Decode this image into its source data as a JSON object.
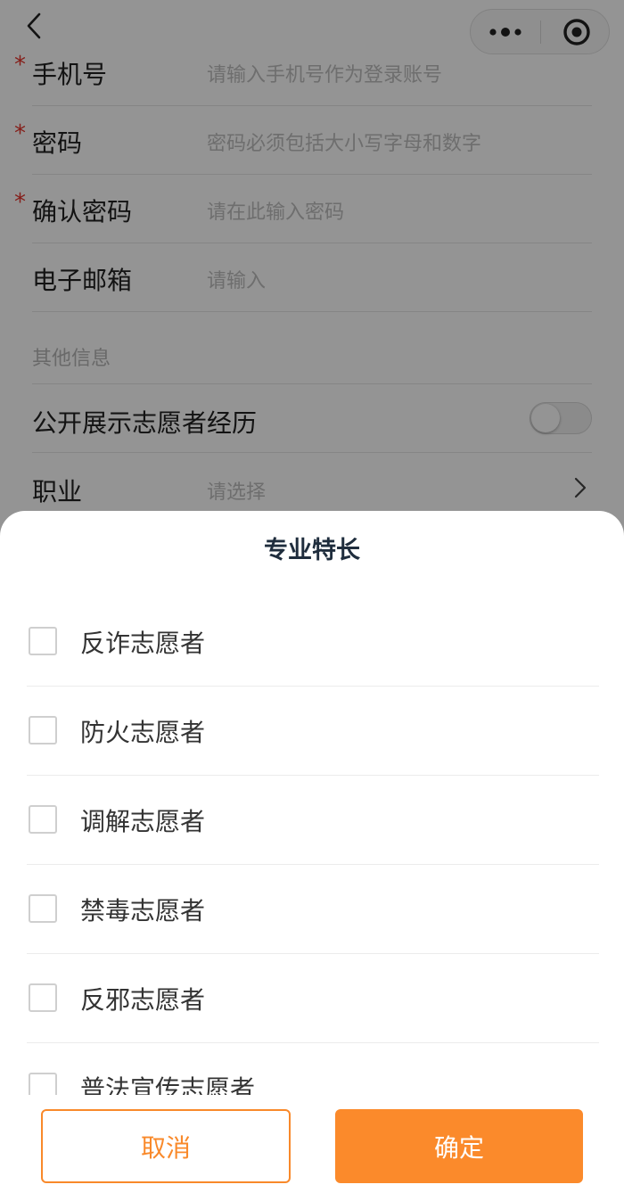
{
  "form": {
    "fields": [
      {
        "label": "手机号",
        "required": "*",
        "placeholder": "请输入手机号作为登录账号"
      },
      {
        "label": "密码",
        "required": "*",
        "placeholder": "密码必须包括大小写字母和数字"
      },
      {
        "label": "确认密码",
        "required": "*",
        "placeholder": "请在此输入密码"
      },
      {
        "label": "电子邮箱",
        "required": "",
        "placeholder": "请输入"
      }
    ],
    "section_other": "其他信息",
    "public_history_label": "公开展示志愿者经历",
    "public_history_on": false,
    "occupation_label": "职业",
    "occupation_placeholder": "请选择"
  },
  "sheet": {
    "title": "专业特长",
    "options": [
      {
        "label": "反诈志愿者",
        "checked": false
      },
      {
        "label": "防火志愿者",
        "checked": false
      },
      {
        "label": "调解志愿者",
        "checked": false
      },
      {
        "label": "禁毒志愿者",
        "checked": false
      },
      {
        "label": "反邪志愿者",
        "checked": false
      },
      {
        "label": "普法宣传志愿者",
        "checked": false
      }
    ],
    "cancel_label": "取消",
    "confirm_label": "确定"
  },
  "icons": {
    "back": "chevron-left-icon",
    "more": "more-dots-icon",
    "close": "target-close-icon",
    "chevron": "chevron-right-icon"
  },
  "colors": {
    "accent": "#fb8a2b",
    "required": "#e5342b",
    "overlay": "rgba(0,0,0,0.42)"
  }
}
